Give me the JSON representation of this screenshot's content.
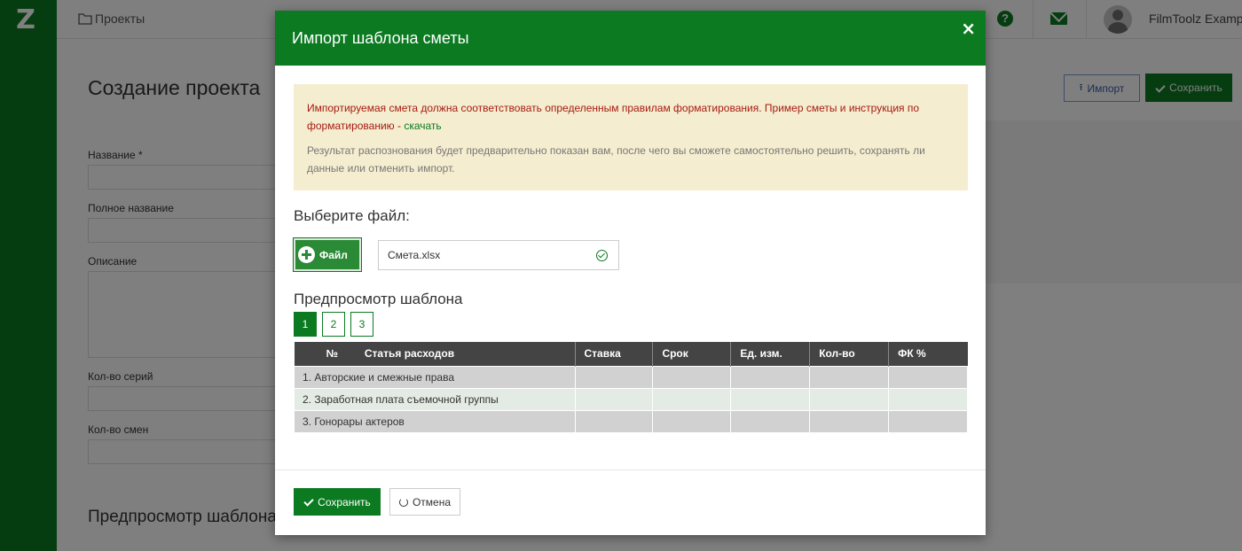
{
  "app": {
    "logo_text": "Z",
    "breadcrumb": "Проекты",
    "user_name": "FilmToolz Example"
  },
  "page": {
    "title": "Создание проекта",
    "import_button": "Импорт",
    "save_button": "Сохранить",
    "fields": {
      "name": "Название *",
      "full_name": "Полное название",
      "description": "Описание",
      "series_count": "Кол-во серий",
      "shifts_count": "Кол-во смен"
    },
    "preview_section": "Предпросмотр шаблона"
  },
  "modal": {
    "title": "Импорт шаблона сметы",
    "close": "×",
    "alert": {
      "warning": "Импортируемая смета должна соответствовать определенным правилам форматирования. Пример сметы и инструкция по форматированию - ",
      "link": "скачать",
      "note": "Результат распознования будет предварительно показан вам, после чего вы сможете самостоятельно решить, сохранять ли данные или отменить импорт."
    },
    "choose_file_label": "Выберите файл:",
    "file_button": "Файл",
    "file_name": "Смета.xlsx",
    "preview_title": "Предпросмотр шаблона",
    "pages": [
      "1",
      "2",
      "3"
    ],
    "active_page": "1",
    "table": {
      "columns": [
        "№",
        "Статья расходов",
        "Ставка",
        "Срок",
        "Ед. изм.",
        "Кол-во",
        "ФК %"
      ],
      "rows": [
        [
          "1. Авторские и смежные права",
          "",
          "",
          "",
          "",
          ""
        ],
        [
          "2. Заработная плата съемочной группы",
          "",
          "",
          "",
          "",
          ""
        ],
        [
          "3. Гонорары актеров",
          "",
          "",
          "",
          "",
          ""
        ]
      ]
    },
    "save_button": "Сохранить",
    "cancel_button": "Отмена"
  },
  "colors": {
    "brand_green": "#0b7a20",
    "warning_red": "#a61a12",
    "alert_bg": "#f5edcf",
    "header_dark": "#444444"
  },
  "icons": [
    "folder-icon",
    "help-icon",
    "mail-icon",
    "avatar",
    "upload-icon",
    "check-icon",
    "close-icon",
    "plus-icon",
    "check-circle-icon",
    "undo-icon"
  ]
}
